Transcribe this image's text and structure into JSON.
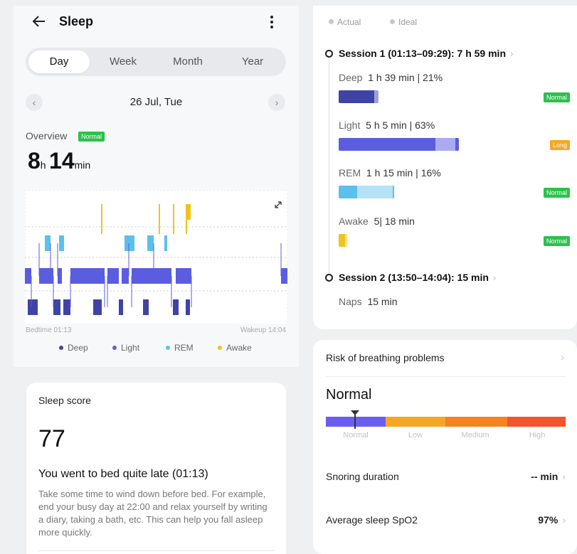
{
  "header": {
    "title": "Sleep"
  },
  "tabs": [
    "Day",
    "Week",
    "Month",
    "Year"
  ],
  "active_tab": "Day",
  "date": "26 Jul, Tue",
  "overview": {
    "label": "Overview",
    "badge": "Normal",
    "hours": "8",
    "hours_unit": "h",
    "minutes": "14",
    "minutes_unit": "min"
  },
  "timeline": {
    "bedtime": "Bedtime 01:13",
    "wakeup": "Wakeup 14:04"
  },
  "legend": [
    {
      "label": "Deep",
      "color": "#3f43a6"
    },
    {
      "label": "Light",
      "color": "#5b5de0"
    },
    {
      "label": "REM",
      "color": "#5bc0eb"
    },
    {
      "label": "Awake",
      "color": "#f0c419"
    }
  ],
  "score": {
    "label": "Sleep score",
    "value": "77",
    "headline": "You went to bed quite late (01:13)",
    "description": "Take some time to wind down before bed. For example, end your busy day at 22:00 and relax yourself by writing a diary, taking a bath, etc. This can help you fall asleep more quickly."
  },
  "actual_ideal": {
    "actual": "Actual",
    "ideal": "Ideal"
  },
  "session1": {
    "label": "Session 1 (01:13–09:29): 7 h 59 min"
  },
  "stages": [
    {
      "name": "Deep",
      "value": "1 h 39 min | 21%",
      "badge": "Normal",
      "badge_color": "#2dc04d",
      "fraction": 0.21,
      "color": "#3f43a6"
    },
    {
      "name": "Light",
      "value": "5 h 5 min | 63%",
      "badge": "Long",
      "badge_color": "#f5a623",
      "fraction": 0.63,
      "color": "#5b5de0"
    },
    {
      "name": "REM",
      "value": "1 h 15 min | 16%",
      "badge": "Normal",
      "badge_color": "#2dc04d",
      "fraction": 0.16,
      "color": "#5bc0eb"
    },
    {
      "name": "Awake",
      "value": "5| 18 min",
      "badge": "Normal",
      "badge_color": "#2dc04d",
      "color": "#f0c419"
    }
  ],
  "session2": {
    "label": "Session 2 (13:50–14:04): 15 min"
  },
  "naps": {
    "label": "Naps",
    "value": "15 min"
  },
  "breathing": {
    "title": "Risk of breathing problems",
    "status": "Normal",
    "levels": [
      {
        "label": "Normal",
        "color": "#6a5ef2"
      },
      {
        "label": "Low",
        "color": "#f5a623"
      },
      {
        "label": "Medium",
        "color": "#f5821f"
      },
      {
        "label": "High",
        "color": "#f4542b"
      }
    ]
  },
  "snoring": {
    "label": "Snoring duration",
    "value": "-- min"
  },
  "spo2": {
    "label": "Average sleep SpO2",
    "value": "97%"
  }
}
